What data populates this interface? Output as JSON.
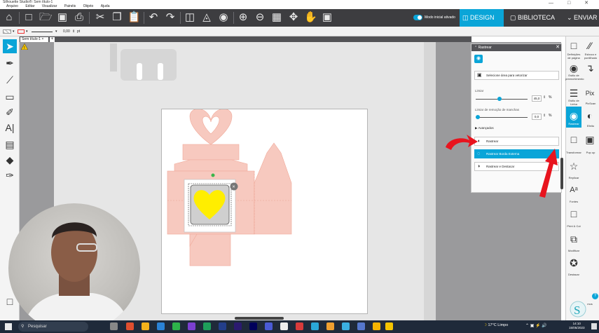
{
  "window": {
    "title": "Silhouette Studio®: Sem título-1",
    "controls": "— □ ✕"
  },
  "menu": [
    "Arquivo",
    "Editar",
    "Visualizar",
    "Painéis",
    "Objeto",
    "Ajuda"
  ],
  "toolbar": {
    "toggle_label": "Modo inicial ativado",
    "design": "DESIGN",
    "library": "BIBLIOTECA",
    "send": "ENVIAR"
  },
  "subbar": {
    "line_width": "0,00",
    "unit": "pt"
  },
  "document": {
    "tab_title": "Sem título-1",
    "tab_close": "×",
    "tab_add": "+"
  },
  "trace_panel": {
    "title": "Rastrear",
    "select_area": "Selecione área para vetorizar",
    "threshold_label": "Limiar",
    "threshold_value": "45,0",
    "threshold_fraction": 0.45,
    "spot_label": "Limiar de remoção de manchas",
    "spot_value": "0,0",
    "spot_fraction": 0.0,
    "unit": "%",
    "advanced": "Avançados",
    "btn_trace": "Rastrear",
    "btn_trace_outer": "Rastrear Borda Externa",
    "btn_trace_detach": "Rastrear e Destacar"
  },
  "right_panel": {
    "page_setup": "Definições de página",
    "sketch": "Esboco e pontilhado",
    "fill": "Estilo de preenchimento",
    "line": "Estilo de Linha",
    "pixscan": "PixScan",
    "trace": "Rastrear",
    "offset": "Efeito",
    "transform": "Transformar",
    "popup": "Pop up",
    "replicate": "Replicar",
    "fonts": "Fontes",
    "print_cut": "Print & Cut",
    "modify": "Modificar",
    "detach": "Destacar",
    "bottom_text": "mos"
  },
  "taskbar": {
    "search": "Pesquisar",
    "weather": "17°C  Limpo",
    "time": "14:10",
    "date": "15/05/2023"
  },
  "colors": {
    "accent": "#0aa5d8",
    "toolbar": "#3d3d40",
    "heart": "#ffee00",
    "design_pink": "#f7c9bf",
    "annotation": "#e8141e"
  }
}
